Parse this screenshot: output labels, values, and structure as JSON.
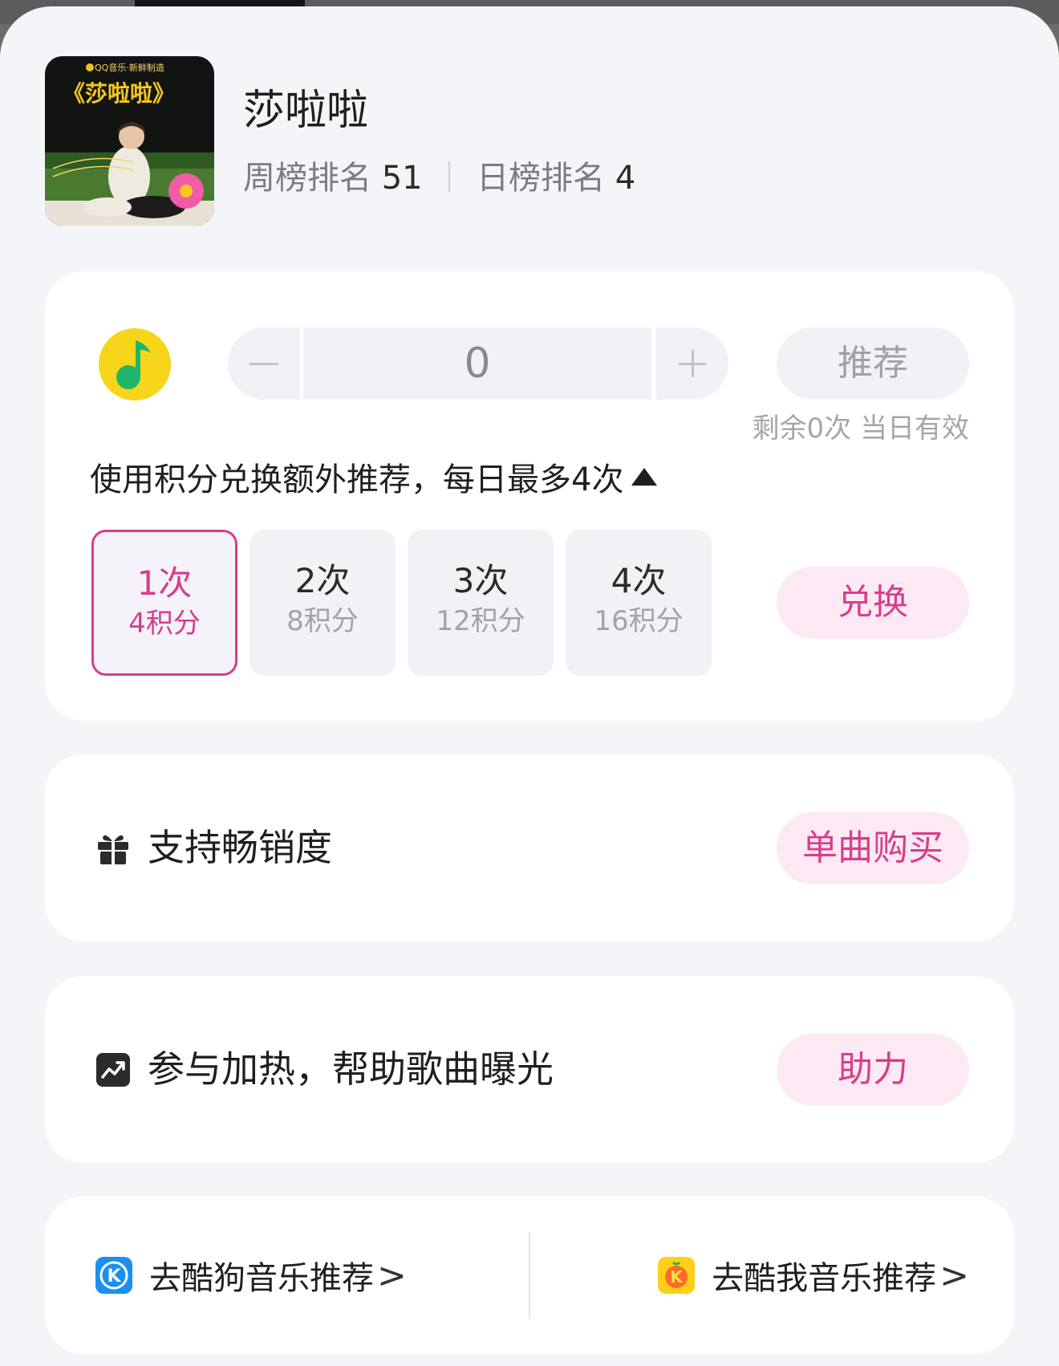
{
  "song": {
    "title": "莎啦啦",
    "weekly_label": "周榜排名",
    "weekly_rank": "51",
    "daily_label": "日榜排名",
    "daily_rank": "4",
    "cover_badge": "QQ音乐·新鲜制造",
    "cover_title": "《莎啦啦》"
  },
  "recommend": {
    "count_value": "0",
    "button_label": "推荐",
    "remaining_note": "剩余0次 当日有效",
    "exchange_note": "使用积分兑换额外推荐，每日最多4次",
    "options": [
      {
        "times": "1次",
        "points": "4积分",
        "selected": true
      },
      {
        "times": "2次",
        "points": "8积分",
        "selected": false
      },
      {
        "times": "3次",
        "points": "12积分",
        "selected": false
      },
      {
        "times": "4次",
        "points": "16积分",
        "selected": false
      }
    ],
    "exchange_button": "兑换"
  },
  "support": {
    "label": "支持畅销度",
    "button": "单曲购买",
    "icon": "gift-icon"
  },
  "heat": {
    "label": "参与加热，帮助歌曲曝光",
    "button": "助力",
    "icon": "trend-chart-icon"
  },
  "links": {
    "kugou": {
      "label": "去酷狗音乐推荐",
      "chevron": ">"
    },
    "kuwo": {
      "label": "去酷我音乐推荐",
      "chevron": ">"
    }
  },
  "colors": {
    "accent": "#d63d8c",
    "accent_bg": "#fde9f3",
    "page_bg": "#f4f5f9",
    "qq_yellow": "#f7d51a",
    "qq_green": "#1fb66c",
    "kugou_blue": "#1a8ff0",
    "kuwo_yellow": "#ffcf1a"
  }
}
